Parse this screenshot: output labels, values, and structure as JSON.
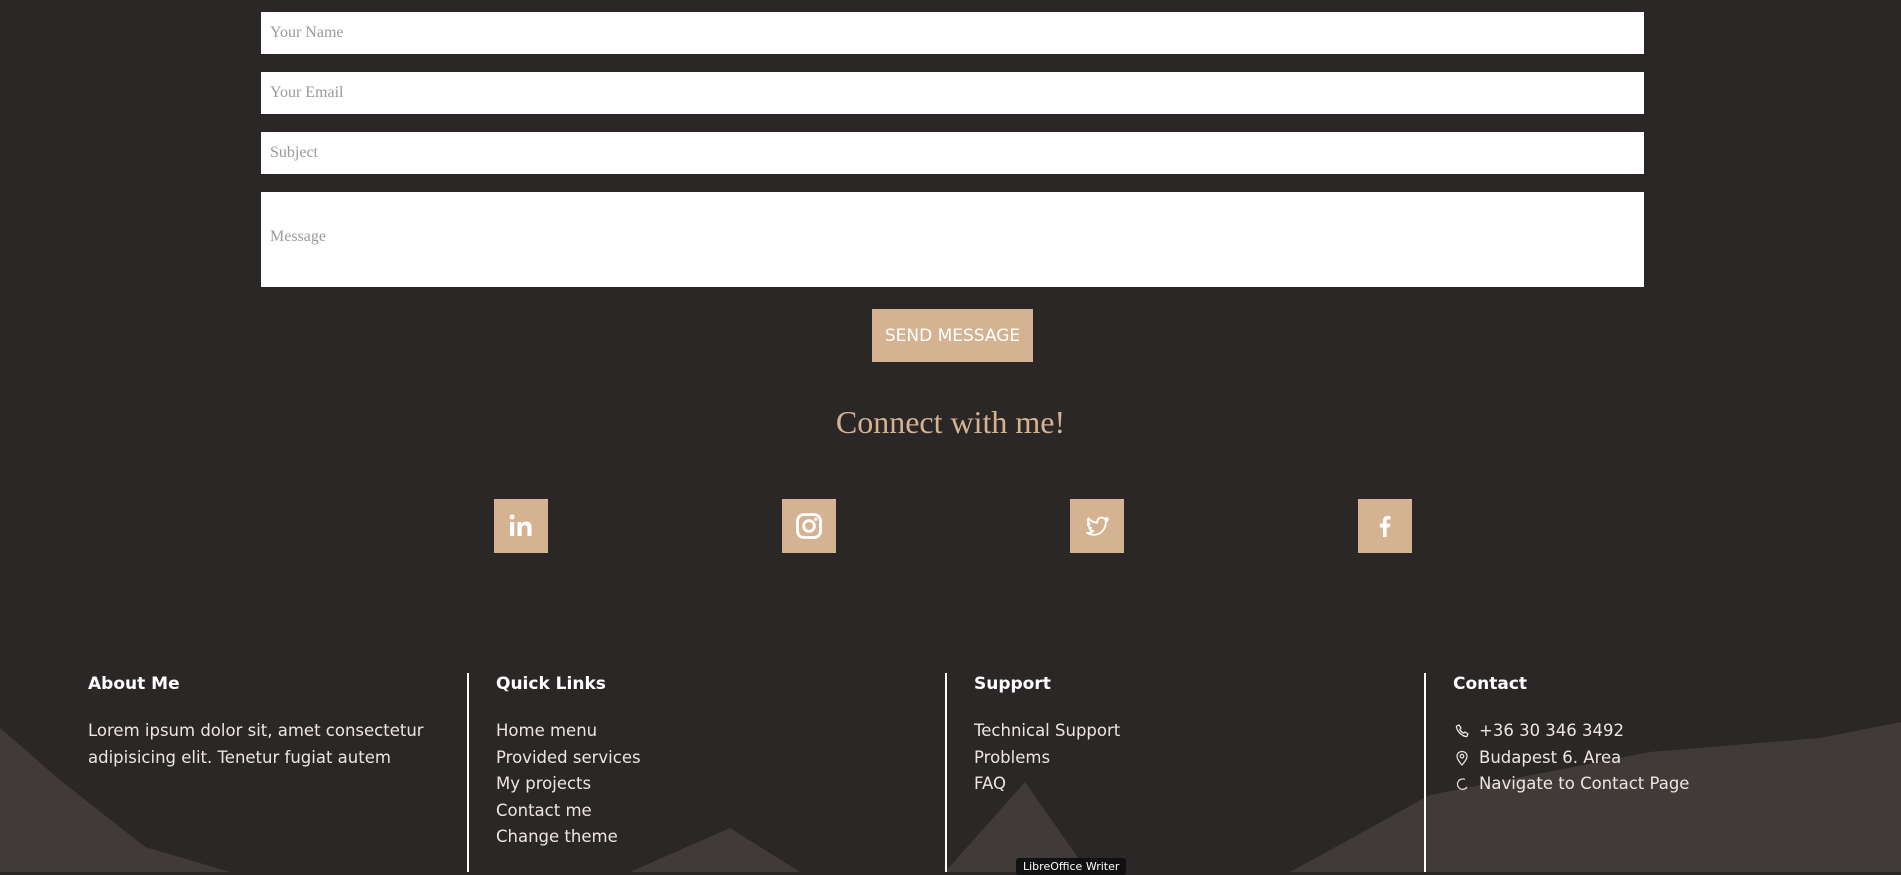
{
  "form": {
    "name_placeholder": "Your Name",
    "email_placeholder": "Your Email",
    "subject_placeholder": "Subject",
    "message_placeholder": "Message",
    "send_label": "SEND MESSAGE"
  },
  "connect": {
    "heading": "Connect with me!",
    "icons": [
      "linkedin-icon",
      "instagram-icon",
      "twitter-icon",
      "facebook-icon"
    ]
  },
  "footer": {
    "about": {
      "title": "About Me",
      "text": "Lorem ipsum dolor sit, amet consectetur adipisicing elit. Tenetur fugiat autem"
    },
    "quick_links": {
      "title": "Quick Links",
      "items": [
        "Home menu",
        "Provided services",
        "My projects",
        "Contact me",
        "Change theme"
      ]
    },
    "support": {
      "title": "Support",
      "items": [
        "Technical Support",
        "Problems",
        "FAQ"
      ]
    },
    "contact": {
      "title": "Contact",
      "phone": "+36 30 346 3492",
      "address": "Budapest 6. Area",
      "navigate": "Navigate to Contact Page"
    }
  },
  "tooltip": "LibreOffice Writer",
  "colors": {
    "background": "#2c2727",
    "accent": "#d5b392",
    "mountain": "#403b38"
  }
}
